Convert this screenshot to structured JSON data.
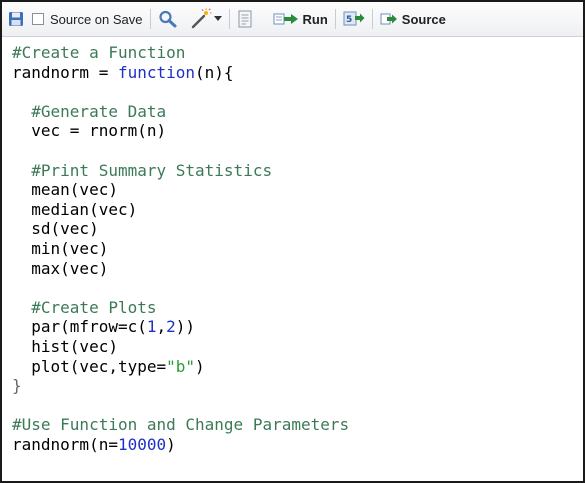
{
  "toolbar": {
    "save_icon": "save-floppy-icon",
    "source_on_save_label": "Source on Save",
    "search_icon": "search-magnifier-icon",
    "wand_icon": "code-tools-wand-icon",
    "dropdown_icon": "chevron-down-icon",
    "outline_icon": "document-outline-icon",
    "run_label": "Run",
    "rerun_icon": "rerun-icon",
    "source_label": "Source",
    "colors": {
      "accent": "#2a8c3a",
      "toolbar_bg": "#eef0f3"
    }
  },
  "editor": {
    "colors": {
      "comment": "#3c7a57",
      "keyword": "#1f2fc8",
      "string": "#2e9b3a",
      "number": "#1f2fc8",
      "text": "#000000"
    },
    "lines": [
      {
        "tokens": [
          {
            "t": "#Create a Function",
            "c": "comment"
          }
        ]
      },
      {
        "tokens": [
          {
            "t": "randnorm = ",
            "c": "plain"
          },
          {
            "t": "function",
            "c": "kw"
          },
          {
            "t": "(n){",
            "c": "plain"
          }
        ]
      },
      {
        "tokens": []
      },
      {
        "tokens": [
          {
            "t": "  ",
            "c": "plain"
          },
          {
            "t": "#Generate Data",
            "c": "comment"
          }
        ]
      },
      {
        "tokens": [
          {
            "t": "  vec = rnorm(n)",
            "c": "plain"
          }
        ]
      },
      {
        "tokens": []
      },
      {
        "tokens": [
          {
            "t": "  ",
            "c": "plain"
          },
          {
            "t": "#Print Summary Statistics",
            "c": "comment"
          }
        ]
      },
      {
        "tokens": [
          {
            "t": "  mean(vec)",
            "c": "plain"
          }
        ]
      },
      {
        "tokens": [
          {
            "t": "  median(vec)",
            "c": "plain"
          }
        ]
      },
      {
        "tokens": [
          {
            "t": "  sd(vec)",
            "c": "plain"
          }
        ]
      },
      {
        "tokens": [
          {
            "t": "  min(vec)",
            "c": "plain"
          }
        ]
      },
      {
        "tokens": [
          {
            "t": "  max(vec)",
            "c": "plain"
          }
        ]
      },
      {
        "tokens": []
      },
      {
        "tokens": [
          {
            "t": "  ",
            "c": "plain"
          },
          {
            "t": "#Create Plots",
            "c": "comment"
          }
        ]
      },
      {
        "tokens": [
          {
            "t": "  par(mfrow=c(",
            "c": "plain"
          },
          {
            "t": "1",
            "c": "num"
          },
          {
            "t": ",",
            "c": "plain"
          },
          {
            "t": "2",
            "c": "num"
          },
          {
            "t": "))",
            "c": "plain"
          }
        ]
      },
      {
        "tokens": [
          {
            "t": "  hist(vec)",
            "c": "plain"
          }
        ]
      },
      {
        "tokens": [
          {
            "t": "  plot(vec,type=",
            "c": "plain"
          },
          {
            "t": "\"b\"",
            "c": "str"
          },
          {
            "t": ")",
            "c": "plain"
          }
        ]
      },
      {
        "tokens": [
          {
            "t": "}",
            "c": "brace"
          }
        ]
      },
      {
        "tokens": []
      },
      {
        "tokens": [
          {
            "t": "#Use Function and Change Parameters",
            "c": "comment"
          }
        ]
      },
      {
        "tokens": [
          {
            "t": "randnorm(n=",
            "c": "plain"
          },
          {
            "t": "10000",
            "c": "num"
          },
          {
            "t": ")",
            "c": "plain"
          }
        ]
      }
    ]
  }
}
